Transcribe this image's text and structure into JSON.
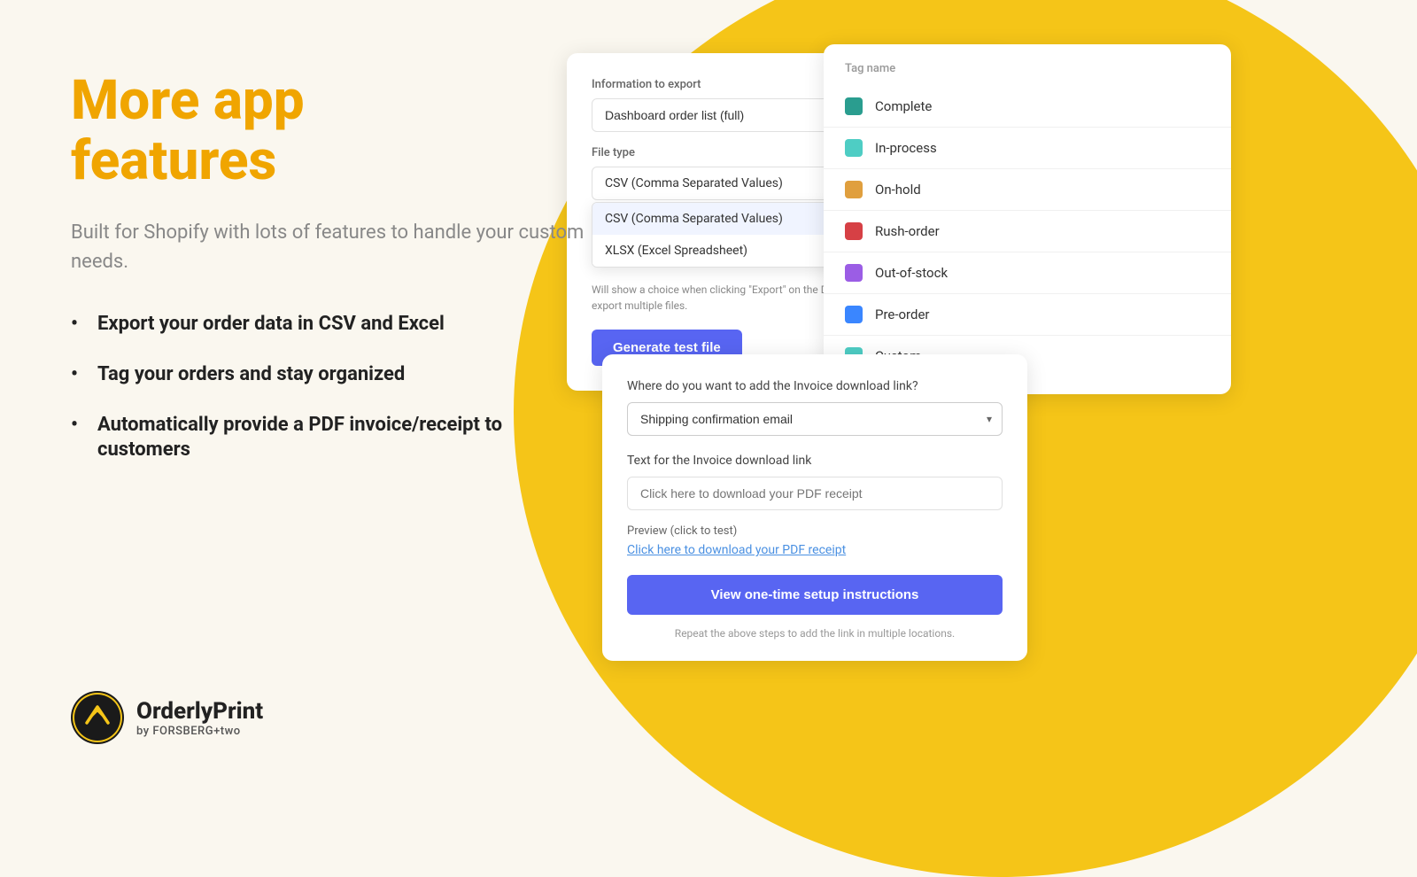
{
  "page": {
    "background": "#faf7ef"
  },
  "left": {
    "title_line1": "More app",
    "title_line2": "features",
    "subtitle": "Built for Shopify with lots of features to handle your custom needs.",
    "features": [
      "Export your order data in CSV and Excel",
      "Tag your orders and stay organized",
      "Automatically provide a PDF invoice/receipt to customers"
    ]
  },
  "logo": {
    "name": "OrderlyPrint",
    "sub": "by FORSBERG+two"
  },
  "export_panel": {
    "info_label": "Information to export",
    "info_value": "Dashboard order list (full)",
    "file_type_label": "File type",
    "file_type_value": "CSV (Comma Separated Values)",
    "dropdown_options": [
      "CSV (Comma Separated Values)",
      "XLSX (Excel Spreadsheet)"
    ],
    "hint": "Will show a choice when clicking \"Export\" on the Dashboard. Useful if you need to export multiple files.",
    "btn_label": "Generate test file"
  },
  "tag_panel": {
    "title": "Tag name",
    "tags": [
      {
        "name": "Complete",
        "color": "#2a9d8f"
      },
      {
        "name": "In-process",
        "color": "#4ecdc4"
      },
      {
        "name": "On-hold",
        "color": "#e09f3e"
      },
      {
        "name": "Rush-order",
        "color": "#d64045"
      },
      {
        "name": "Out-of-stock",
        "color": "#9b5de5"
      },
      {
        "name": "Pre-order",
        "color": "#3a86ff"
      },
      {
        "name": "Custom",
        "color": "#4ecdc4"
      }
    ]
  },
  "invoice_panel": {
    "where_label": "Where do you want to add the Invoice download link?",
    "where_value": "Shipping confirmation email",
    "text_label": "Text for the Invoice download link",
    "text_placeholder": "Click here to download your PDF receipt",
    "preview_label": "Preview (click to test)",
    "preview_link": "Click here to download your PDF receipt",
    "btn_label": "View one-time setup instructions",
    "repeat_text": "Repeat the above steps to add the link in multiple locations."
  }
}
